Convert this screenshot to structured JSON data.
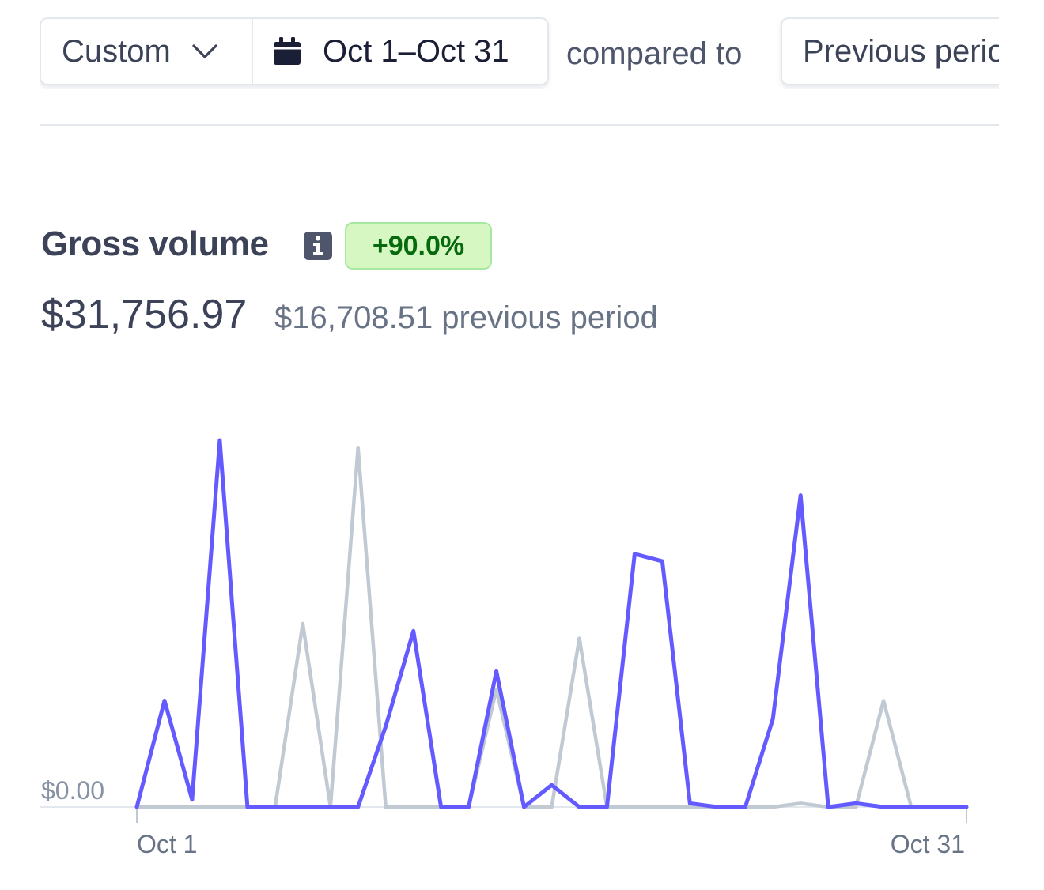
{
  "toolbar": {
    "range_preset": "Custom",
    "date_range": "Oct 1–Oct 31",
    "compared_to": "compared to",
    "comparison": "Previous period"
  },
  "metric": {
    "title": "Gross volume",
    "change_badge": "+90.0%",
    "value": "$31,756.97",
    "previous": "$16,708.51 previous period"
  },
  "colors": {
    "current_series": "#635bff",
    "previous_series": "#c1c9d2",
    "badge_bg": "#d7f7c2",
    "badge_text": "#05690d"
  },
  "icons": {
    "dropdown": "chevron-down-icon",
    "calendar": "calendar-icon",
    "info": "info-icon"
  },
  "chart_data": {
    "type": "line",
    "x": [
      "Oct 1",
      "Oct 2",
      "Oct 3",
      "Oct 4",
      "Oct 5",
      "Oct 6",
      "Oct 7",
      "Oct 8",
      "Oct 9",
      "Oct 10",
      "Oct 11",
      "Oct 12",
      "Oct 13",
      "Oct 14",
      "Oct 15",
      "Oct 16",
      "Oct 17",
      "Oct 18",
      "Oct 19",
      "Oct 20",
      "Oct 21",
      "Oct 22",
      "Oct 23",
      "Oct 24",
      "Oct 25",
      "Oct 26",
      "Oct 27",
      "Oct 28",
      "Oct 29",
      "Oct 30",
      "Oct 31"
    ],
    "x_tick_labels": [
      "Oct 1",
      "Oct 31"
    ],
    "y_tick_labels": [
      "$0.00"
    ],
    "ylim": [
      0,
      100
    ],
    "grid": false,
    "series": [
      {
        "color": "#635bff",
        "values": [
          0,
          29,
          2,
          100,
          0,
          0,
          0,
          0,
          0,
          22,
          48,
          0,
          0,
          37,
          0,
          6,
          0,
          0,
          69,
          67,
          1,
          0,
          0,
          24,
          85,
          0,
          1,
          0,
          0,
          0,
          0
        ]
      },
      {
        "color": "#c1c9d2",
        "values": [
          0,
          0,
          0,
          0,
          0,
          0,
          50,
          0,
          98,
          0,
          0,
          0,
          0,
          32,
          0,
          0,
          46,
          0,
          0,
          0,
          0,
          0,
          0,
          0,
          1,
          0,
          0,
          29,
          0,
          0,
          0
        ]
      }
    ]
  }
}
